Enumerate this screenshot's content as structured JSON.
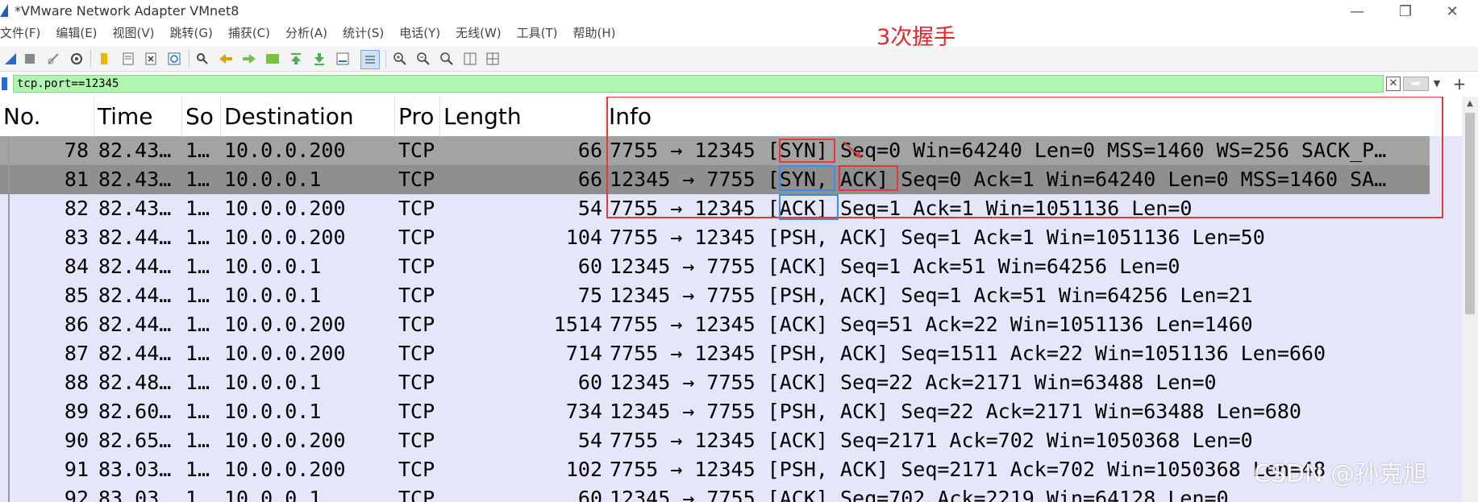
{
  "window": {
    "title": "*VMware Network Adapter VMnet8",
    "controls": {
      "minimize": "—",
      "maximize": "❐",
      "close": "✕"
    }
  },
  "menu": [
    "文件(F)",
    "编辑(E)",
    "视图(V)",
    "跳转(G)",
    "捕获(C)",
    "分析(A)",
    "统计(S)",
    "电话(Y)",
    "无线(W)",
    "工具(T)",
    "帮助(H)"
  ],
  "toolbar_icons": [
    "shark-fin-start-icon",
    "stop-square-icon",
    "restart-icon",
    "options-gear-icon",
    "open-folder-icon",
    "save-file-icon",
    "close-file-icon",
    "reload-icon",
    "find-packet-icon",
    "go-back-icon",
    "go-forward-icon",
    "go-to-packet-icon",
    "go-first-icon",
    "go-last-icon",
    "auto-scroll-icon",
    "colorize-icon",
    "zoom-in-icon",
    "zoom-out-icon",
    "zoom-normal-icon",
    "resize-columns-icon",
    "layout-icon"
  ],
  "annotation": {
    "title": "3次握手",
    "color": "#e8242b"
  },
  "filter": {
    "value": "tcp.port==12345",
    "background": "#b0f5b0"
  },
  "columns": [
    "No.",
    "Time",
    "So",
    "Destination",
    "Pro",
    "Length",
    "Info"
  ],
  "packets": [
    {
      "no": "78",
      "time": "82.43…",
      "src": "1…",
      "dst": "10.0.0.200",
      "proto": "TCP",
      "len": "66",
      "info": "7755 → 12345  [SYN]  Seq=0 Win=64240 Len=0 MSS=1460 WS=256 SACK_P…"
    },
    {
      "no": "81",
      "time": "82.43…",
      "src": "1…",
      "dst": "10.0.0.1",
      "proto": "TCP",
      "len": "66",
      "info": "12345 → 7755  [SYN, ACK]  Seq=0 Ack=1 Win=64240 Len=0 MSS=1460 SA…"
    },
    {
      "no": "82",
      "time": "82.43…",
      "src": "1…",
      "dst": "10.0.0.200",
      "proto": "TCP",
      "len": "54",
      "info": "7755 → 12345  [ACK] Seq=1 Ack=1 Win=1051136 Len=0"
    },
    {
      "no": "83",
      "time": "82.44…",
      "src": "1…",
      "dst": "10.0.0.200",
      "proto": "TCP",
      "len": "104",
      "info": "7755 → 12345  [PSH, ACK] Seq=1 Ack=1 Win=1051136 Len=50"
    },
    {
      "no": "84",
      "time": "82.44…",
      "src": "1…",
      "dst": "10.0.0.1",
      "proto": "TCP",
      "len": "60",
      "info": "12345 → 7755  [ACK] Seq=1 Ack=51 Win=64256 Len=0"
    },
    {
      "no": "85",
      "time": "82.44…",
      "src": "1…",
      "dst": "10.0.0.1",
      "proto": "TCP",
      "len": "75",
      "info": "12345 → 7755  [PSH, ACK] Seq=1 Ack=51 Win=64256 Len=21"
    },
    {
      "no": "86",
      "time": "82.44…",
      "src": "1…",
      "dst": "10.0.0.200",
      "proto": "TCP",
      "len": "1514",
      "info": "7755 → 12345  [ACK] Seq=51 Ack=22 Win=1051136 Len=1460"
    },
    {
      "no": "87",
      "time": "82.44…",
      "src": "1…",
      "dst": "10.0.0.200",
      "proto": "TCP",
      "len": "714",
      "info": "7755 → 12345  [PSH, ACK] Seq=1511 Ack=22 Win=1051136 Len=660"
    },
    {
      "no": "88",
      "time": "82.48…",
      "src": "1…",
      "dst": "10.0.0.1",
      "proto": "TCP",
      "len": "60",
      "info": "12345 → 7755  [ACK] Seq=22 Ack=2171 Win=63488 Len=0"
    },
    {
      "no": "89",
      "time": "82.60…",
      "src": "1…",
      "dst": "10.0.0.1",
      "proto": "TCP",
      "len": "734",
      "info": "12345 → 7755  [PSH, ACK] Seq=22 Ack=2171 Win=63488 Len=680"
    },
    {
      "no": "90",
      "time": "82.65…",
      "src": "1…",
      "dst": "10.0.0.200",
      "proto": "TCP",
      "len": "54",
      "info": "7755 → 12345  [ACK] Seq=2171 Ack=702 Win=1050368 Len=0"
    },
    {
      "no": "91",
      "time": "83.03…",
      "src": "1…",
      "dst": "10.0.0.200",
      "proto": "TCP",
      "len": "102",
      "info": "7755 → 12345  [PSH, ACK] Seq=2171 Ack=702 Win=1050368 Len=48"
    },
    {
      "no": "92",
      "time": "83.03…",
      "src": "1…",
      "dst": "10.0.0.1",
      "proto": "TCP",
      "len": "60",
      "info": "12345 → 7755  [ACK] Seq=702 Ack=2219 Win=64128 Len=0"
    }
  ],
  "watermark": "CSDN @孙克旭"
}
